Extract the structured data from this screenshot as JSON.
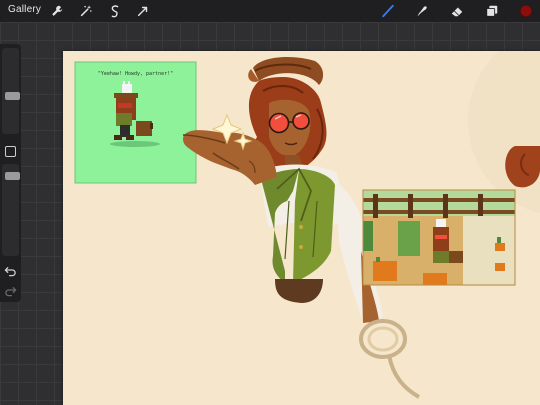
{
  "toolbar": {
    "gallery_label": "Gallery",
    "left_tools": [
      "wrench-icon",
      "magic-wand-icon",
      "selection-icon",
      "transform-arrow-icon"
    ],
    "right_tools": [
      "brush-icon",
      "smudge-icon",
      "eraser-icon",
      "layers-icon",
      "color-swatch"
    ],
    "active_tool": "brush-icon",
    "accent_color": "#2f7cf6",
    "current_color": "#8b0e0e"
  },
  "sidebar": {
    "brush_size_level": 0.25,
    "opacity_level": 0.6,
    "icons": [
      "modify-button",
      "undo-icon",
      "redo-icon"
    ]
  },
  "canvas": {
    "background_color": "#f5e6cc",
    "pixel_panel_caption": "\"Yeehaw! Howdy, partner!\""
  }
}
